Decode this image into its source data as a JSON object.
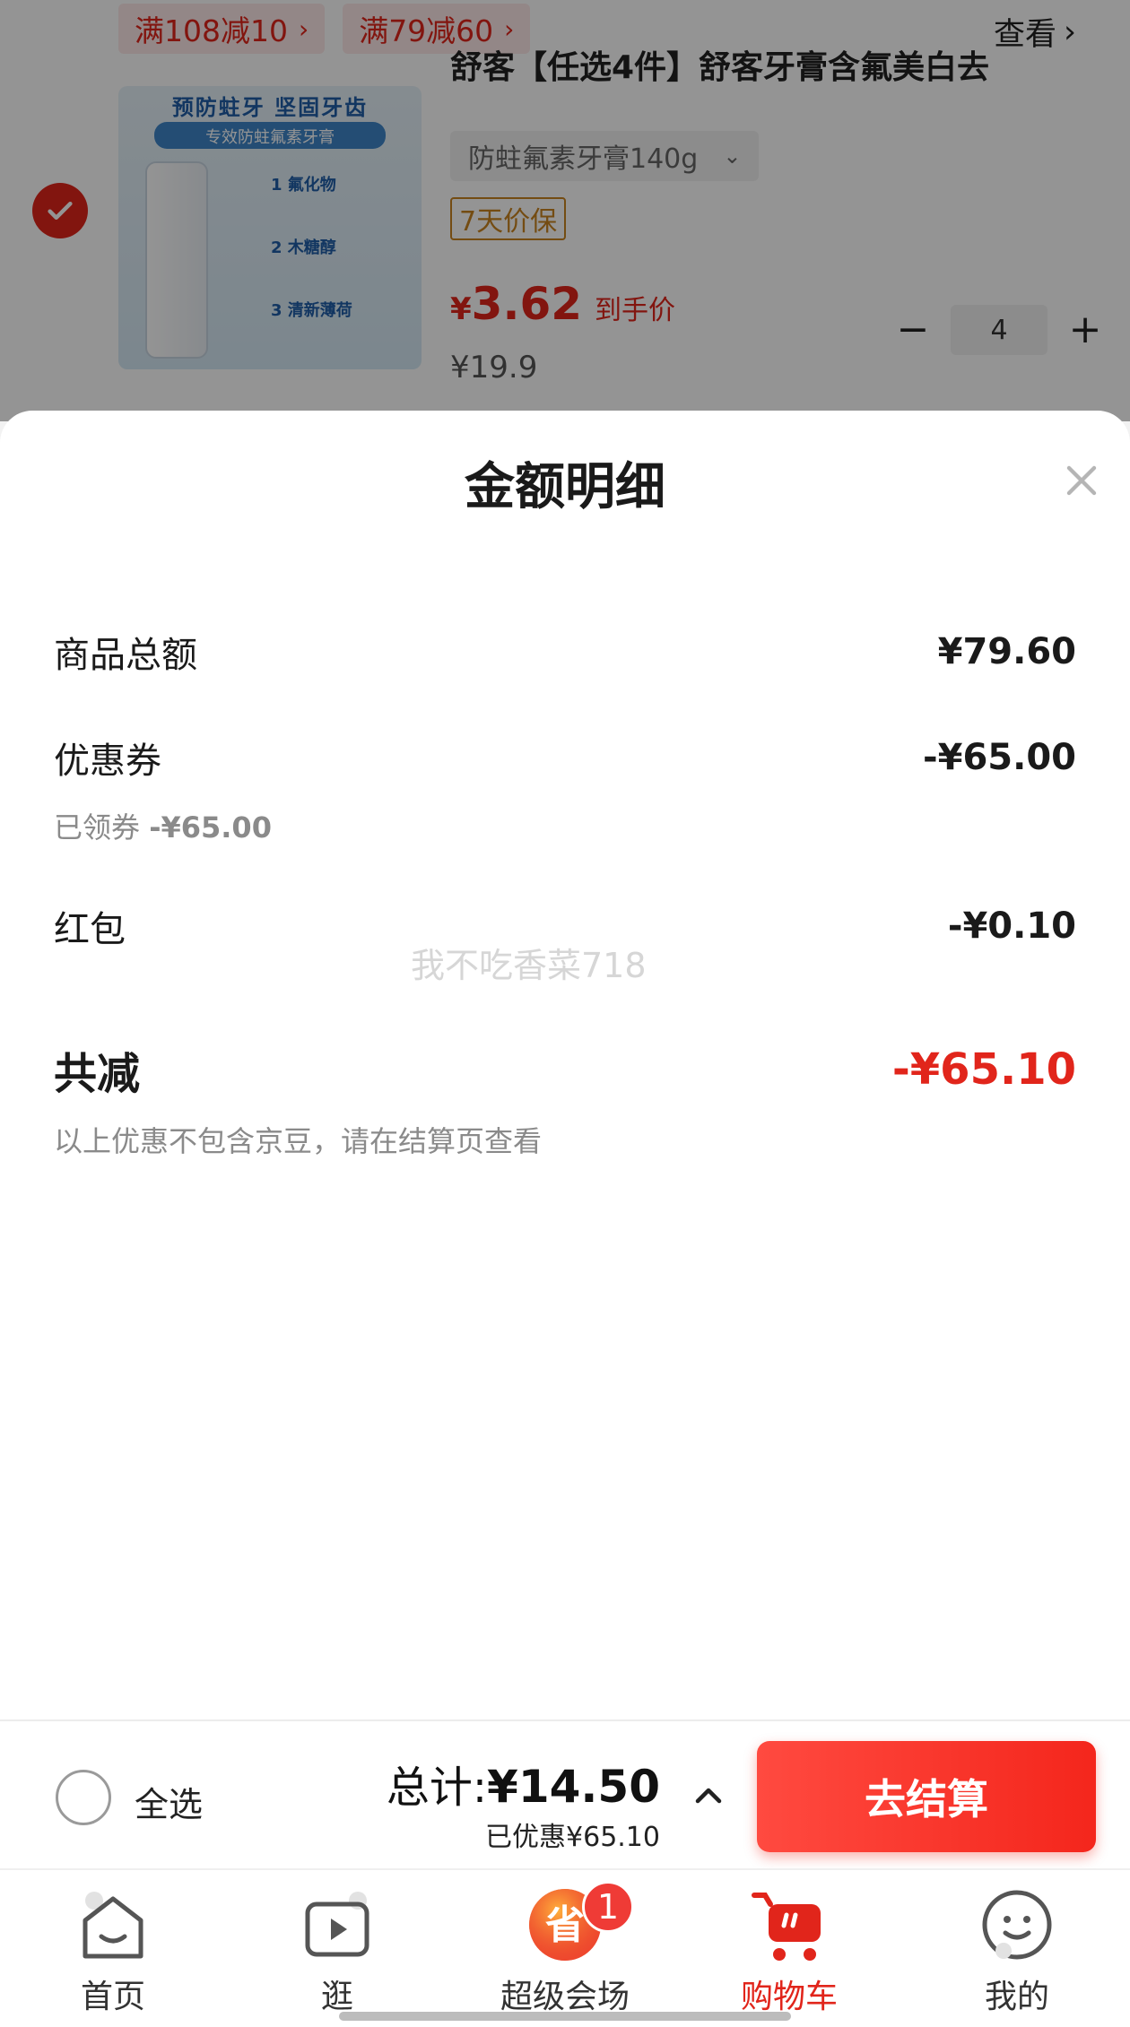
{
  "cart_item": {
    "promos": [
      {
        "label": "满108减10"
      },
      {
        "label": "满79减60"
      }
    ],
    "view_label": "查看",
    "title": "舒客【任选4件】舒客牙膏含氟美白去",
    "image_banner": "预防蛀牙 坚固牙齿",
    "image_subbanner": "专效防蛀氟素牙膏",
    "image_features": [
      "1 氟化物",
      "2 木糖醇",
      "3 清新薄荷"
    ],
    "spec": "防蛀氟素牙膏140g",
    "price_protect": "7天价保",
    "price_currency": "¥",
    "price_now": "3.62",
    "price_label": "到手价",
    "price_original": "¥19.9",
    "quantity": "4"
  },
  "sheet": {
    "title": "金额明细",
    "rows": {
      "goods_total": {
        "label": "商品总额",
        "value": "¥79.60"
      },
      "coupon": {
        "label": "优惠券",
        "value": "-¥65.00",
        "note_prefix": "已领券",
        "note_value": "-¥65.00"
      },
      "red_packet": {
        "label": "红包",
        "value": "-¥0.10"
      },
      "total_reduce": {
        "label": "共减",
        "value": "-¥65.10"
      }
    },
    "footnote": "以上优惠不包含京豆，请在结算页查看",
    "watermark": "我不吃香菜718"
  },
  "checkout": {
    "select_all_label": "全选",
    "total_prefix": "总计:",
    "total_value": "¥14.50",
    "saved_text": "已优惠¥65.10",
    "button_label": "去结算"
  },
  "nav": {
    "items": [
      {
        "label": "首页",
        "icon": "home-icon"
      },
      {
        "label": "逛",
        "icon": "video-icon"
      },
      {
        "label": "超级会场",
        "icon": "super-venue-icon",
        "badge": "1"
      },
      {
        "label": "购物车",
        "icon": "cart-icon"
      },
      {
        "label": "我的",
        "icon": "profile-icon"
      }
    ],
    "active_index": 3
  },
  "colors": {
    "accent": "#e1251b",
    "price_protect": "#c9831f"
  }
}
